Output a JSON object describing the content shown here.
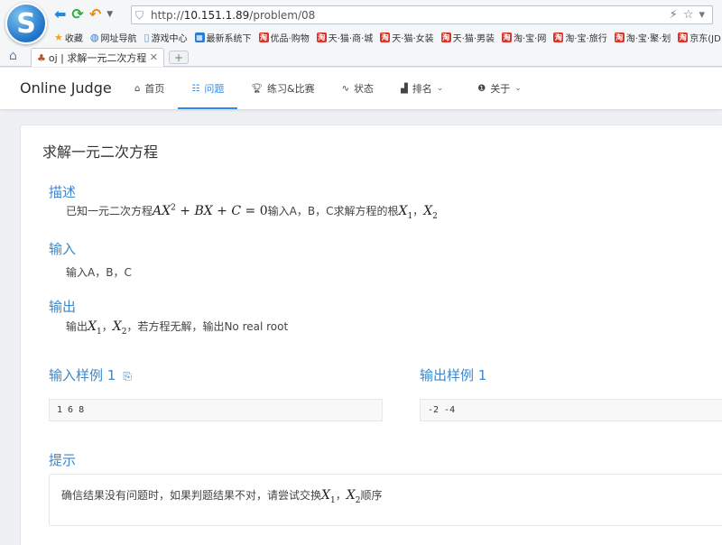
{
  "browser": {
    "logo_letter": "S",
    "url_prefix": "http://",
    "url_host": "10.151.1.89",
    "url_path": "/problem/08",
    "bookmarks": [
      {
        "label": "收藏",
        "icon": "star-icon"
      },
      {
        "label": "网址导航",
        "icon": "globe-icon"
      },
      {
        "label": "游戏中心",
        "icon": "doc-icon"
      },
      {
        "label": "最新系统下",
        "icon": "windows-icon"
      },
      {
        "label": "优品·购物",
        "icon": "taobao-icon"
      },
      {
        "label": "天·猫·商·城",
        "icon": "taobao-icon"
      },
      {
        "label": "天·猫·女装",
        "icon": "taobao-icon"
      },
      {
        "label": "天·猫·男装",
        "icon": "taobao-icon"
      },
      {
        "label": "淘·宝·网",
        "icon": "taobao-icon"
      },
      {
        "label": "淘·宝·旅行",
        "icon": "taobao-icon"
      },
      {
        "label": "淘·宝·聚·划",
        "icon": "taobao-icon"
      },
      {
        "label": "京东(JD",
        "icon": "taobao-icon"
      }
    ],
    "tab_title": "oj | 求解一元二次方程",
    "tao_glyph": "淘"
  },
  "nav": {
    "brand": "Online Judge",
    "items": [
      {
        "label": "首页",
        "icon": "home-icon"
      },
      {
        "label": "问题",
        "icon": "grid-icon"
      },
      {
        "label": "练习&比赛",
        "icon": "trophy-icon"
      },
      {
        "label": "状态",
        "icon": "pulse-icon"
      },
      {
        "label": "排名",
        "icon": "bar-chart-icon"
      },
      {
        "label": "关于",
        "icon": "info-icon"
      }
    ]
  },
  "problem": {
    "title": "求解一元二次方程",
    "description_heading": "描述",
    "desc_pre": "已知一元二次方程",
    "desc_mid": "输入A，B，C求解方程的根",
    "desc_sep": "，",
    "input_heading": "输入",
    "input_text": "输入A，B，C",
    "output_heading": "输出",
    "out_pre": "输出",
    "out_sep": "，",
    "out_post": "，若方程无解，输出No real root",
    "sample_in_heading": "输入样例 1",
    "sample_out_heading": "输出样例 1",
    "sample_in": "1 6 8",
    "sample_out": "-2 -4",
    "hint_heading": "提示",
    "hint_pre": "确信结果没有问题时，如果判题结果不对，请尝试交换",
    "hint_sep": "，",
    "hint_post": "顺序"
  },
  "colors": {
    "accent": "#2d8cf0",
    "section": "#3d87cc"
  }
}
